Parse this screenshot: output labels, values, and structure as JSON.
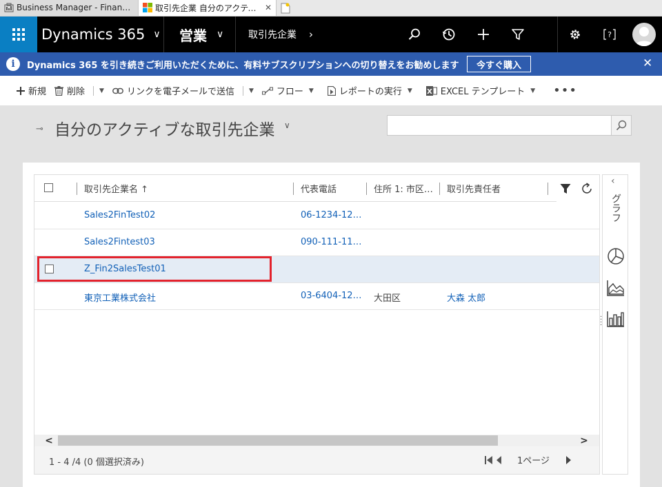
{
  "browser": {
    "tabs": [
      {
        "title": "Business Manager - Finance an...",
        "active": false
      },
      {
        "title": "取引先企業 自分のアクティブ...",
        "active": true,
        "close": "✕"
      }
    ]
  },
  "nav": {
    "brand": "Dynamics 365",
    "module": "営業",
    "entity": "取引先企業"
  },
  "notification": {
    "icon": "i",
    "text": "Dynamics 365 を引き続きご利用いただくために、有料サブスクリプションへの切り替えをお勧めします",
    "button": "今すぐ購入",
    "close": "✕"
  },
  "commands": {
    "new": "新規",
    "delete": "削除",
    "email_link": "リンクを電子メールで送信",
    "flow": "フロー",
    "run_report": "レポートの実行",
    "excel_template": "EXCEL テンプレート"
  },
  "view": {
    "title": "自分のアクティブな取引先企業",
    "search_placeholder": ""
  },
  "grid": {
    "columns": {
      "name": "取引先企業名 ↑",
      "phone": "代表電話",
      "address": "住所 1: 市区…",
      "contact": "取引先責任者"
    },
    "rows": [
      {
        "name": "Sales2FinTest02",
        "phone": "06-1234-12…",
        "city": "",
        "contact": "",
        "selected": false
      },
      {
        "name": "Sales2Fintest03",
        "phone": "090-111-11…",
        "city": "",
        "contact": "",
        "selected": false
      },
      {
        "name": "Z_Fin2SalesTest01",
        "phone": "",
        "city": "",
        "contact": "",
        "selected": true
      },
      {
        "name": "東京工業株式会社",
        "phone": "03-6404-12…",
        "city": "大田区",
        "contact": "大森 太郎",
        "selected": false
      }
    ],
    "status": "1 - 4 /4 (0 個選択済み)",
    "page": "1ページ"
  },
  "side_pane": {
    "label": "グラフ"
  },
  "colors": {
    "nav_bg": "#000000",
    "waffle_bg": "#0a7fc3",
    "notif_bg": "#2e5cae",
    "link": "#1160b7",
    "highlight_border": "#e3222c",
    "selected_row": "#e4ecf5"
  },
  "icons": [
    "waffle-icon",
    "search-icon",
    "recent-icon",
    "plus-icon",
    "filter-icon",
    "settings-icon",
    "help-icon",
    "user-icon"
  ]
}
